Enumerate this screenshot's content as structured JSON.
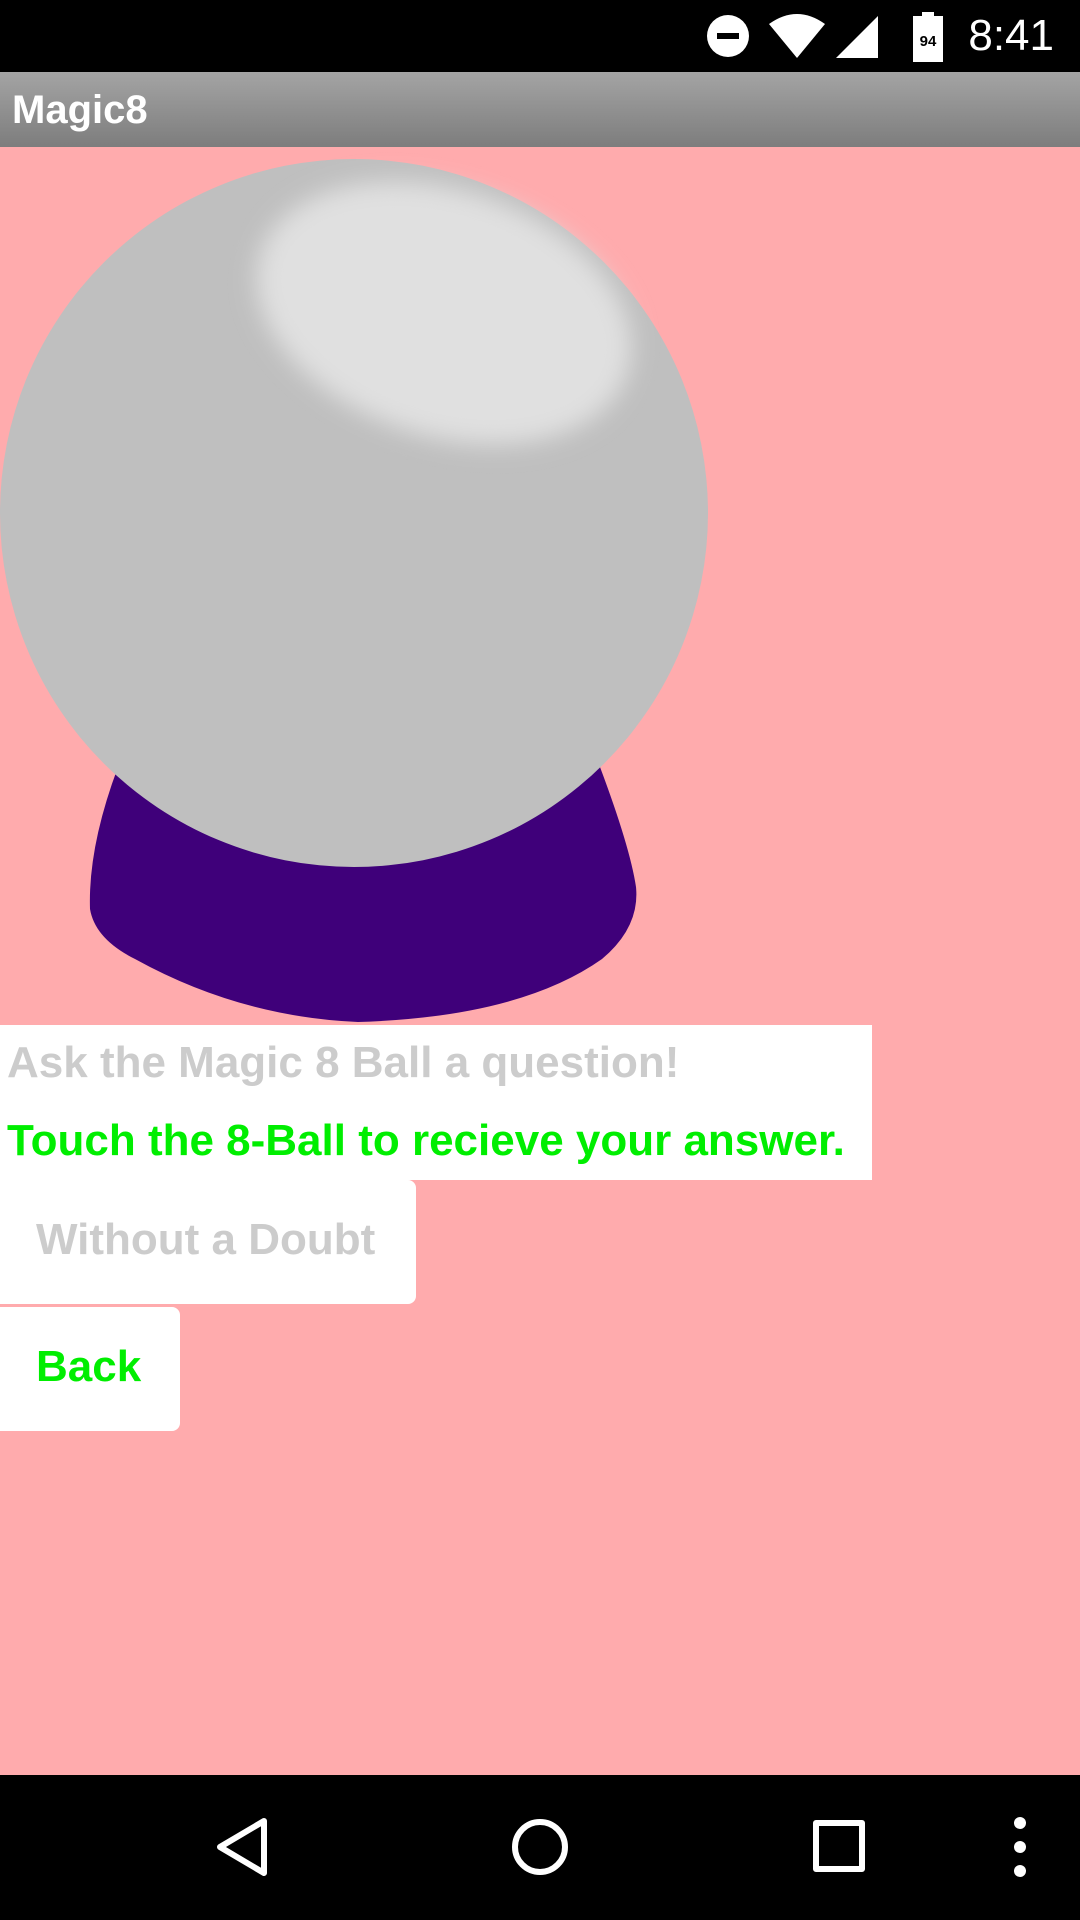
{
  "status_bar": {
    "time": "8:41",
    "battery_level": "94",
    "icons": [
      "do-not-disturb-icon",
      "wifi-icon",
      "cellular-signal-icon",
      "battery-icon"
    ]
  },
  "app_bar": {
    "title": "Magic8"
  },
  "main": {
    "image": "magic-8-ball-icon",
    "question_text": "Ask the Magic 8 Ball a question!",
    "instruction_text": "Touch the 8-Ball to recieve your answer.",
    "answer_button_label": "Without a Doubt",
    "back_button_label": "Back"
  },
  "colors": {
    "background": "#ffabad",
    "ball": "#bfbfbf",
    "ball_highlight": "#e0e0e0",
    "stand": "#3f007a",
    "instruction_text": "#00ee00",
    "muted_text": "#cccccc"
  },
  "nav_bar": {
    "icons": [
      "back-triangle-icon",
      "home-circle-icon",
      "recents-square-icon",
      "overflow-menu-icon"
    ]
  }
}
